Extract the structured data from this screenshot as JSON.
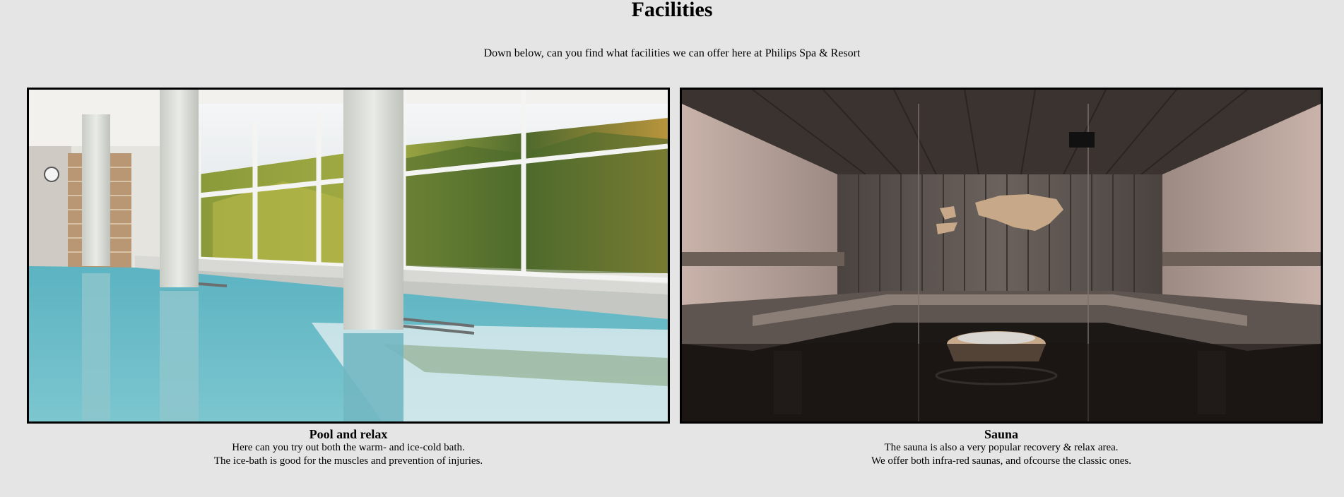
{
  "page": {
    "title": "Facilities",
    "intro": "Down below, can you find what facilities we can offer here at Philips Spa & Resort"
  },
  "facilities": [
    {
      "title": "Pool and relax",
      "image": "indoor-pool-photo",
      "lines": [
        "Here can you try out both the warm- and ice-cold bath.",
        "The ice-bath is good for the muscles and prevention of injuries."
      ]
    },
    {
      "title": "Sauna",
      "image": "sauna-photo",
      "lines": [
        "The sauna is also a very popular recovery & relax area.",
        "We offer both infra-red saunas, and ofcourse the classic ones."
      ]
    }
  ],
  "colors": {
    "background": "#e5e5e5",
    "border": "#000000"
  }
}
